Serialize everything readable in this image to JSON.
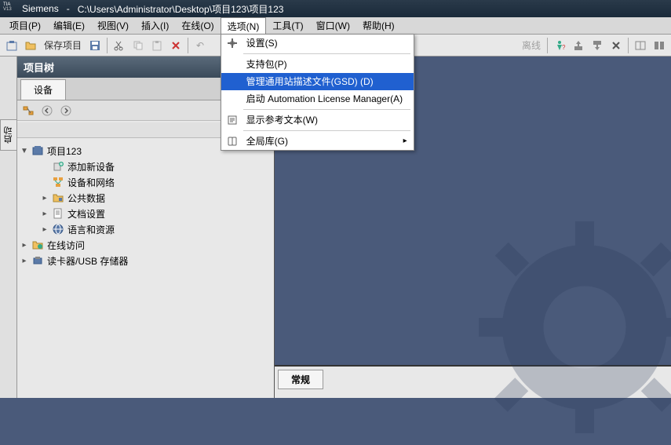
{
  "titlebar": {
    "app": "Siemens",
    "sep": "-",
    "path": "C:\\Users\\Administrator\\Desktop\\项目123\\项目123",
    "logo_top": "TIA",
    "logo_bot": "V13"
  },
  "menubar": {
    "items": [
      "项目(P)",
      "编辑(E)",
      "视图(V)",
      "插入(I)",
      "在线(O)",
      "选项(N)",
      "工具(T)",
      "窗口(W)",
      "帮助(H)"
    ]
  },
  "toolbar": {
    "save_label": "保存项目",
    "offline_label": "离线"
  },
  "dropdown": {
    "items": [
      {
        "label": "设置(S)",
        "icon": "settings"
      },
      {
        "sep": true
      },
      {
        "label": "支持包(P)",
        "icon": ""
      },
      {
        "label": "管理通用站描述文件(GSD) (D)",
        "icon": "",
        "highlighted": true
      },
      {
        "label": "启动 Automation License Manager(A)",
        "icon": ""
      },
      {
        "sep": true
      },
      {
        "label": "显示参考文本(W)",
        "icon": "reftext"
      },
      {
        "sep": true
      },
      {
        "label": "全局库(G)",
        "icon": "library",
        "submenu": true
      }
    ]
  },
  "side_tab": {
    "label": "启动"
  },
  "project_panel": {
    "title": "项目树",
    "tab": "设备"
  },
  "tree": {
    "nodes": [
      {
        "label": "项目123",
        "icon": "project",
        "exp": "▼",
        "lvl": 0
      },
      {
        "label": "添加新设备",
        "icon": "add-device",
        "exp": "",
        "lvl": 1
      },
      {
        "label": "设备和网络",
        "icon": "network",
        "exp": "",
        "lvl": 1
      },
      {
        "label": "公共数据",
        "icon": "folder-data",
        "exp": "▸",
        "lvl": 1
      },
      {
        "label": "文档设置",
        "icon": "doc-settings",
        "exp": "▸",
        "lvl": 1
      },
      {
        "label": "语言和资源",
        "icon": "lang",
        "exp": "▸",
        "lvl": 1
      },
      {
        "label": "在线访问",
        "icon": "online-access",
        "exp": "▸",
        "lvl": 2
      },
      {
        "label": "读卡器/USB 存储器",
        "icon": "card-reader",
        "exp": "▸",
        "lvl": 2
      }
    ]
  },
  "bottom_panel": {
    "tab": "常规"
  }
}
